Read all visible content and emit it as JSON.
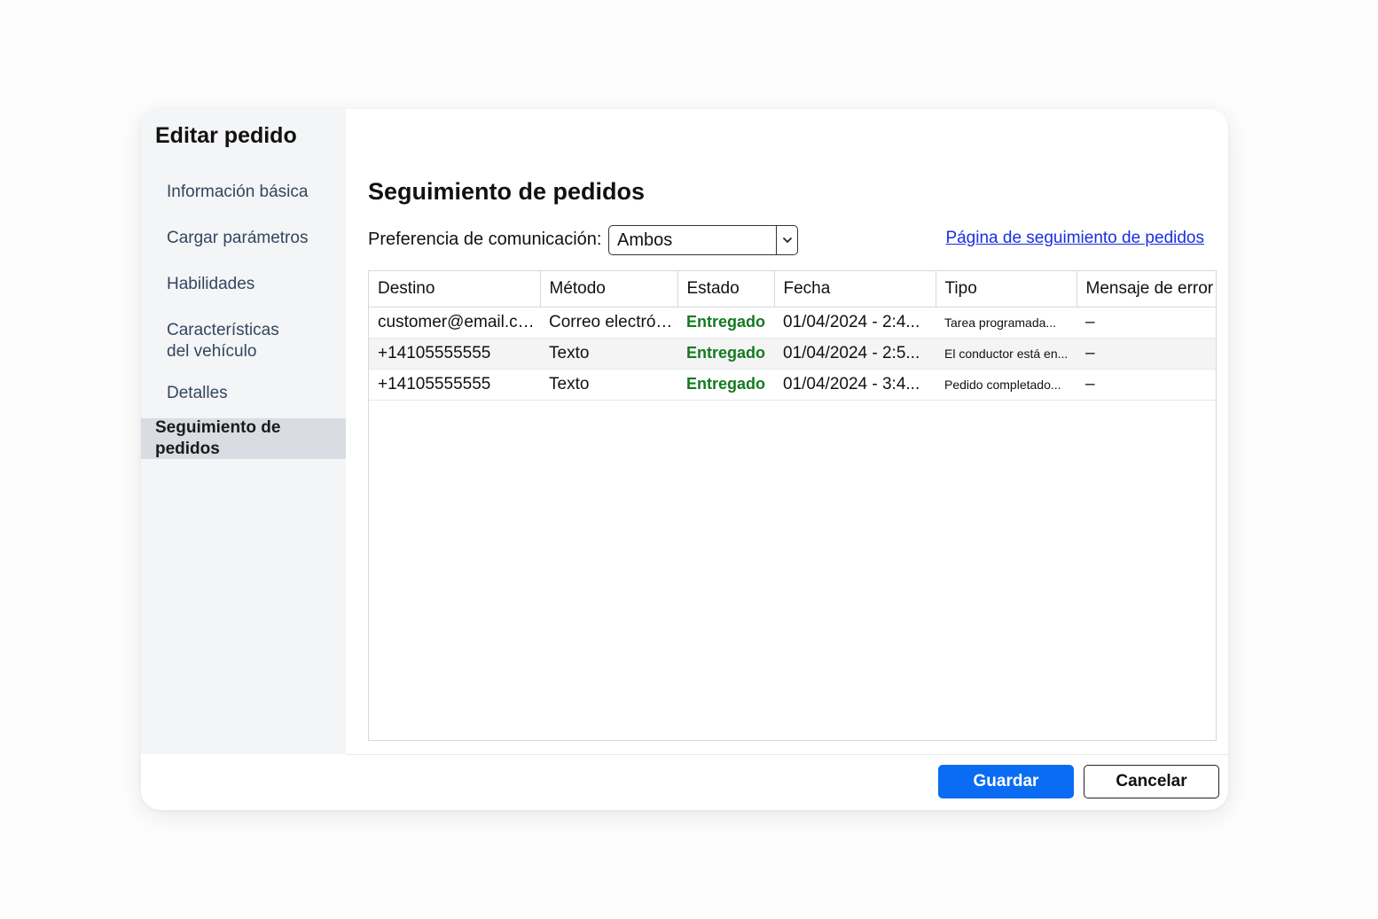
{
  "sidebar": {
    "title": "Editar pedido",
    "items": [
      {
        "label": "Información básica"
      },
      {
        "label": "Cargar parámetros"
      },
      {
        "label": "Habilidades"
      },
      {
        "label": "Características\ndel vehículo"
      },
      {
        "label": "Detalles"
      },
      {
        "label": "Seguimiento de pedidos",
        "active": true
      }
    ]
  },
  "main": {
    "title": "Seguimiento de pedidos",
    "preference_label": "Preferencia de comunicación:",
    "preference_value": "Ambos",
    "tracking_link": "Página de seguimiento de pedidos"
  },
  "table": {
    "headers": [
      "Destino",
      "Método",
      "Estado",
      "Fecha",
      "Tipo",
      "Mensaje de error"
    ],
    "rows": [
      [
        "customer@email.com",
        "Correo electrónico",
        "Entregado",
        "01/04/2024 - 2:4...",
        "Tarea programada...",
        "–"
      ],
      [
        "+14105555555",
        "Texto",
        "Entregado",
        "01/04/2024 - 2:5...",
        "El conductor está en...",
        "–"
      ],
      [
        "+14105555555",
        "Texto",
        "Entregado",
        "01/04/2024 - 3:4...",
        "Pedido completado...",
        "–"
      ]
    ]
  },
  "footer": {
    "save_label": "Guardar",
    "cancel_label": "Cancelar"
  },
  "colors": {
    "accent": "#0a6cf2",
    "status_delivered": "#157a22",
    "link": "#1a2fe0"
  },
  "icons": {
    "select_arrow": "chevron-down-icon"
  }
}
